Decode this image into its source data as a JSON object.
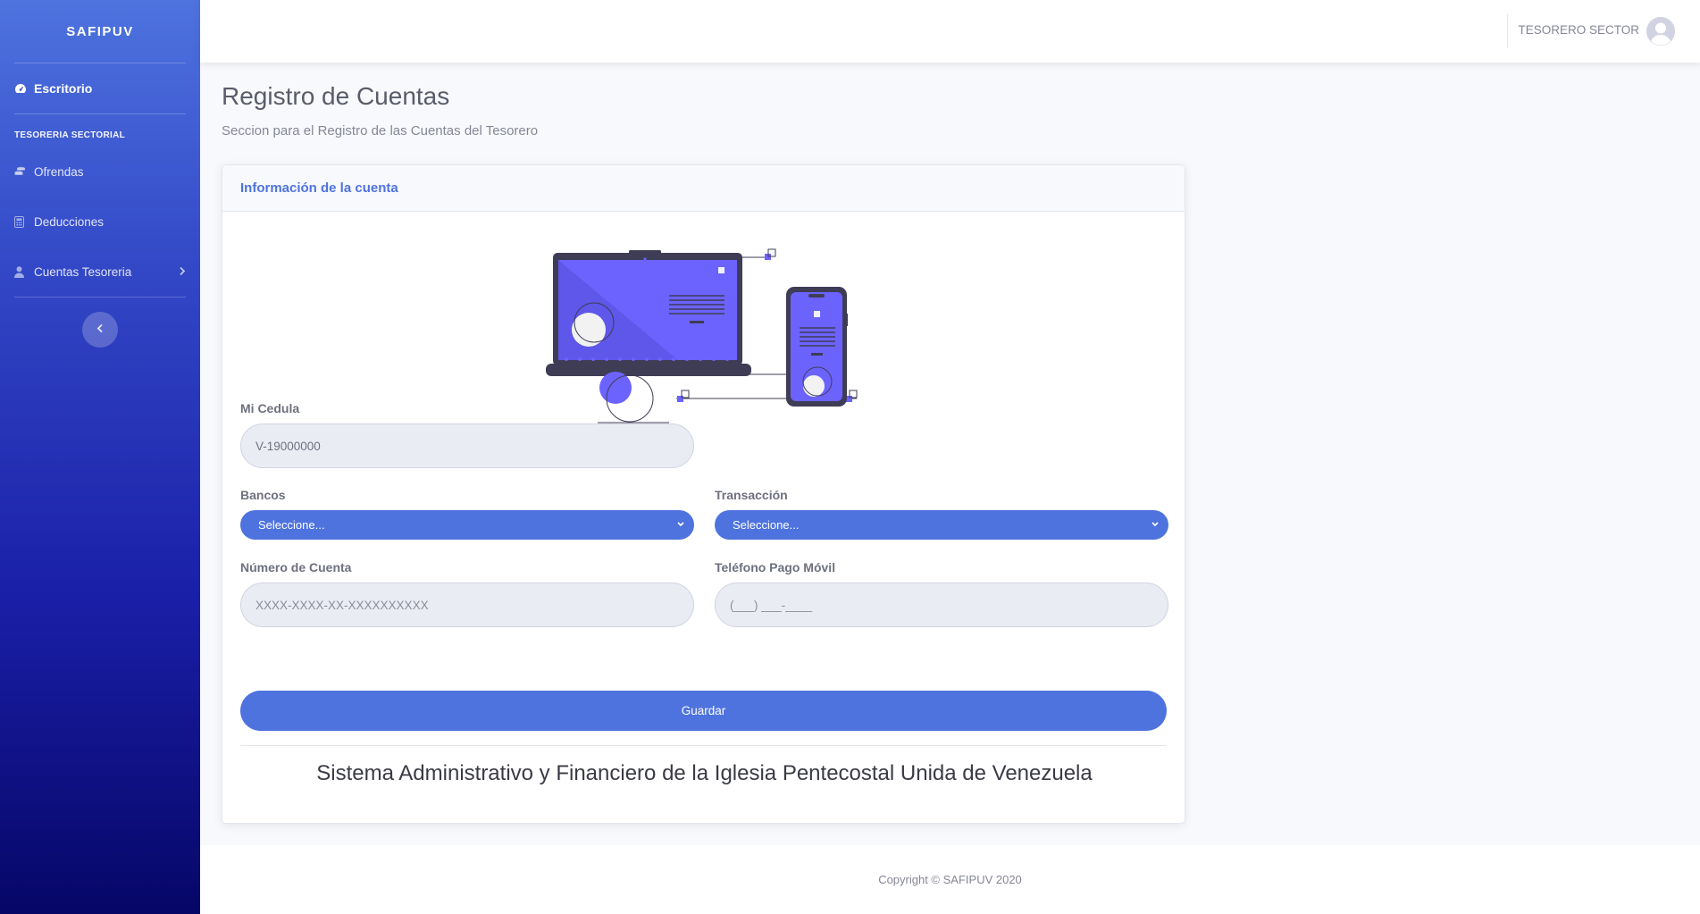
{
  "sidebar": {
    "brand": "SAFIPUV",
    "dashboard": {
      "label": "Escritorio",
      "icon": "tachometer-icon"
    },
    "section_heading": "TESORERIA SECTORIAL",
    "items": [
      {
        "label": "Ofrendas",
        "icon": "coins-icon"
      },
      {
        "label": "Deducciones",
        "icon": "calculator-icon"
      },
      {
        "label": "Cuentas Tesoreria",
        "icon": "user-tie-icon",
        "has_submenu": true
      }
    ],
    "toggle_icon": "chevron-left-icon"
  },
  "topbar": {
    "user_name": "TESORERO SECTOR",
    "avatar_icon": "user-circle-icon"
  },
  "page": {
    "title": "Registro de Cuentas",
    "subtitle": "Seccion para el Registro de las Cuentas del Tesorero"
  },
  "card": {
    "header": "Información de la cuenta",
    "illustration": "laptop-and-phone-illustration",
    "cedula": {
      "label": "Mi Cedula",
      "value": "V-19000000"
    },
    "bancos": {
      "label": "Bancos",
      "selected": "Seleccione..."
    },
    "transaccion": {
      "label": "Transacción",
      "selected": "Seleccione..."
    },
    "numero_cuenta": {
      "label": "Número de Cuenta",
      "placeholder": "XXXX-XXXX-XX-XXXXXXXXXX"
    },
    "telefono": {
      "label": "Teléfono Pago Móvil",
      "placeholder": "(___) ___-____"
    },
    "save_label": "Guardar",
    "system_name": "Sistema Administrativo y Financiero de la Iglesia Pentecostal Unida de Venezuela"
  },
  "footer": {
    "copyright": "Copyright © SAFIPUV 2020"
  },
  "colors": {
    "primary": "#4e73df",
    "illustration_accent": "#6c63ff",
    "text_muted": "#858796"
  }
}
